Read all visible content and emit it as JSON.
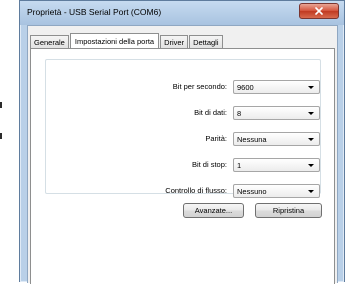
{
  "window": {
    "title": "Proprietà - USB Serial Port (COM6)"
  },
  "tabs": [
    {
      "label": "Generale"
    },
    {
      "label": "Impostazioni della porta"
    },
    {
      "label": "Driver"
    },
    {
      "label": "Dettagli"
    }
  ],
  "active_tab": "Impostazioni della porta",
  "settings": {
    "bits_per_second": {
      "label": "Bit per secondo:",
      "value": "9600"
    },
    "data_bits": {
      "label": "Bit di dati:",
      "value": "8"
    },
    "parity": {
      "label": "Parità:",
      "value": "Nessuna"
    },
    "stop_bits": {
      "label": "Bit di stop:",
      "value": "1"
    },
    "flow_control": {
      "label": "Controllo di flusso:",
      "value": "Nessuno"
    }
  },
  "buttons": {
    "advanced": "Avanzate...",
    "restore": "Ripristina"
  },
  "colors": {
    "frame": "#b9d0e8",
    "close_button": "#d4553e"
  },
  "icons": [
    "close-icon",
    "dropdown-arrow-icon"
  ]
}
